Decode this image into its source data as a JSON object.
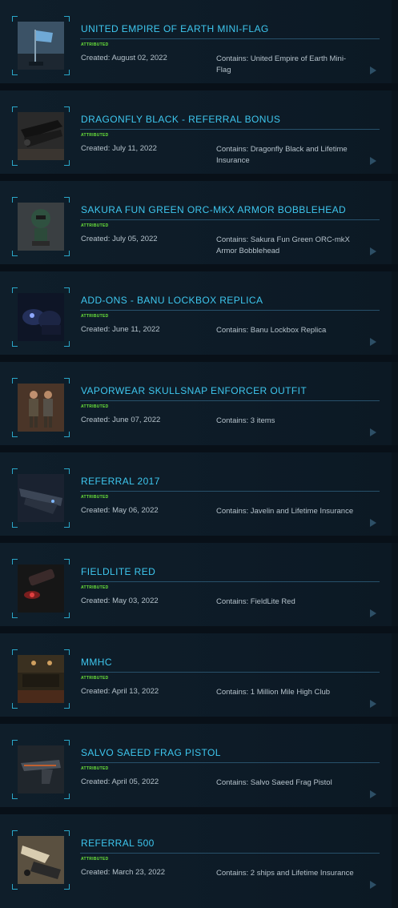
{
  "items": [
    {
      "title": "UNITED EMPIRE OF EARTH MINI-FLAG",
      "badge": "ATTRIBUTED",
      "created": "Created: August 02, 2022",
      "contains": "Contains: United Empire of Earth Mini-Flag"
    },
    {
      "title": "DRAGONFLY BLACK - REFERRAL BONUS",
      "badge": "ATTRIBUTED",
      "created": "Created: July 11, 2022",
      "contains": "Contains: Dragonfly Black and Lifetime Insurance"
    },
    {
      "title": "SAKURA FUN GREEN ORC-MKX ARMOR BOBBLEHEAD",
      "badge": "ATTRIBUTED",
      "created": "Created: July 05, 2022",
      "contains": "Contains: Sakura Fun Green ORC-mkX Armor Bobblehead"
    },
    {
      "title": "ADD-ONS - BANU LOCKBOX REPLICA",
      "badge": "ATTRIBUTED",
      "created": "Created: June 11, 2022",
      "contains": "Contains: Banu Lockbox Replica"
    },
    {
      "title": "VAPORWEAR SKULLSNAP ENFORCER OUTFIT",
      "badge": "ATTRIBUTED",
      "created": "Created: June 07, 2022",
      "contains": "Contains: 3 items"
    },
    {
      "title": "REFERRAL 2017",
      "badge": "ATTRIBUTED",
      "created": "Created: May 06, 2022",
      "contains": "Contains: Javelin and Lifetime Insurance"
    },
    {
      "title": "FIELDLITE RED",
      "badge": "ATTRIBUTED",
      "created": "Created: May 03, 2022",
      "contains": "Contains: FieldLite Red"
    },
    {
      "title": "MMHC",
      "badge": "ATTRIBUTED",
      "created": "Created: April 13, 2022",
      "contains": "Contains: 1 Million Mile High Club"
    },
    {
      "title": "SALVO SAEED FRAG PISTOL",
      "badge": "ATTRIBUTED",
      "created": "Created: April 05, 2022",
      "contains": "Contains: Salvo Saeed Frag Pistol"
    },
    {
      "title": "REFERRAL 500",
      "badge": "ATTRIBUTED",
      "created": "Created: March 23, 2022",
      "contains": "Contains: 2 ships and Lifetime Insurance"
    }
  ]
}
